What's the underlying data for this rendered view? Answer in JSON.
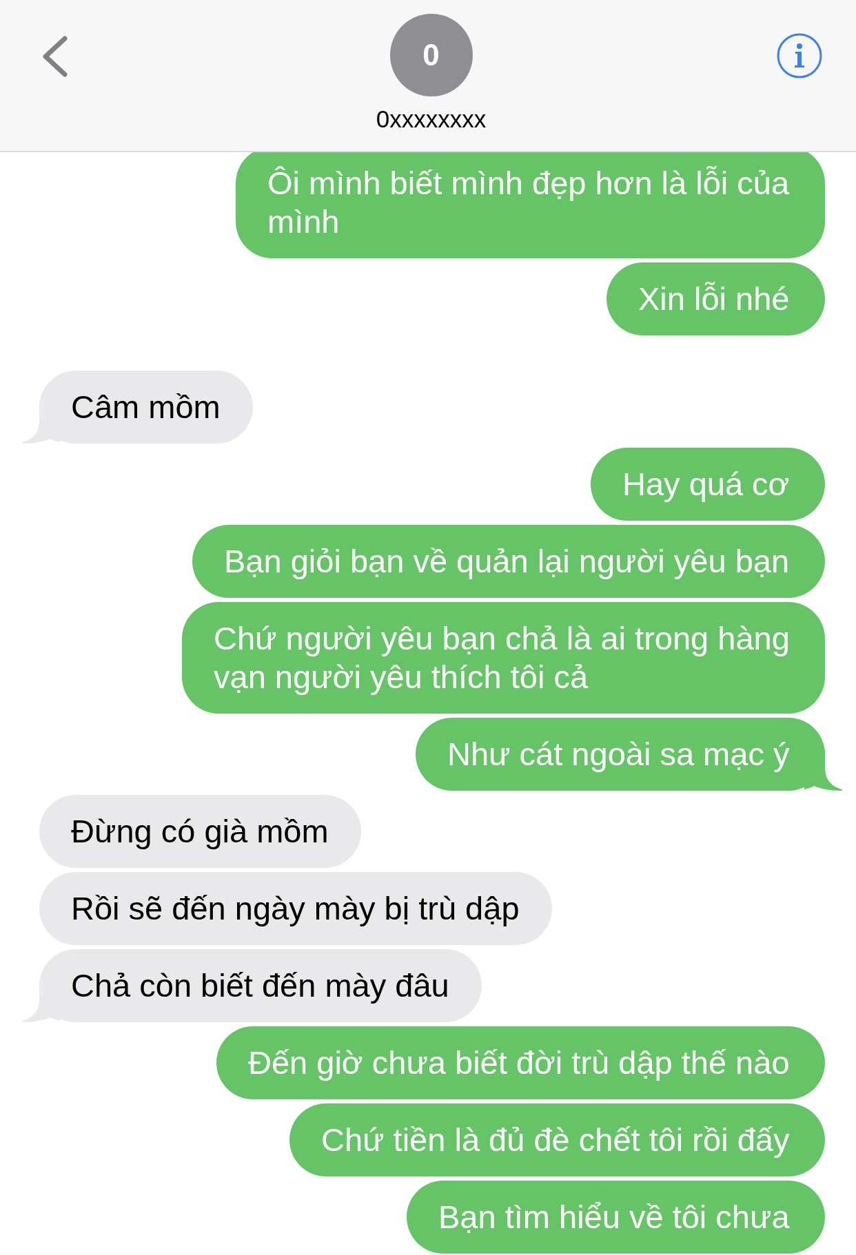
{
  "header": {
    "avatar_initial": "0",
    "contact_name": "0xxxxxxxx"
  },
  "sections": [
    {
      "messages": [
        {
          "kind": "sent",
          "text": "Ôi mình biết mình đẹp hơn là lỗi của mình",
          "tail": false
        },
        {
          "kind": "sent",
          "text": "Xin lỗi nhé",
          "tail": false
        }
      ]
    },
    {
      "messages": [
        {
          "kind": "received",
          "text": "Câm mồm",
          "tail": true
        },
        {
          "kind": "sent",
          "text": "Hay quá cơ",
          "tail": false
        },
        {
          "kind": "sent",
          "text": "Bạn giỏi bạn về quản lại người yêu bạn",
          "tail": false
        },
        {
          "kind": "sent",
          "text": "Chứ người yêu bạn chả là ai trong hàng vạn người yêu thích tôi cả",
          "tail": false
        },
        {
          "kind": "sent",
          "text": "Như cát ngoài sa mạc ý",
          "tail": true
        },
        {
          "kind": "received",
          "text": "Đừng có già mồm",
          "tail": false
        },
        {
          "kind": "received",
          "text": "Rồi sẽ đến ngày mày bị trù dập",
          "tail": false
        },
        {
          "kind": "received",
          "text": "Chả còn biết đến mày đâu",
          "tail": true
        },
        {
          "kind": "sent",
          "text": "Đến giờ chưa biết đời trù dập thế nào",
          "tail": false
        },
        {
          "kind": "sent",
          "text": "Chứ tiền là đủ đè chết tôi rồi đấy",
          "tail": false
        },
        {
          "kind": "sent",
          "text": "Bạn tìm hiểu về tôi chưa",
          "tail": false
        }
      ]
    }
  ]
}
